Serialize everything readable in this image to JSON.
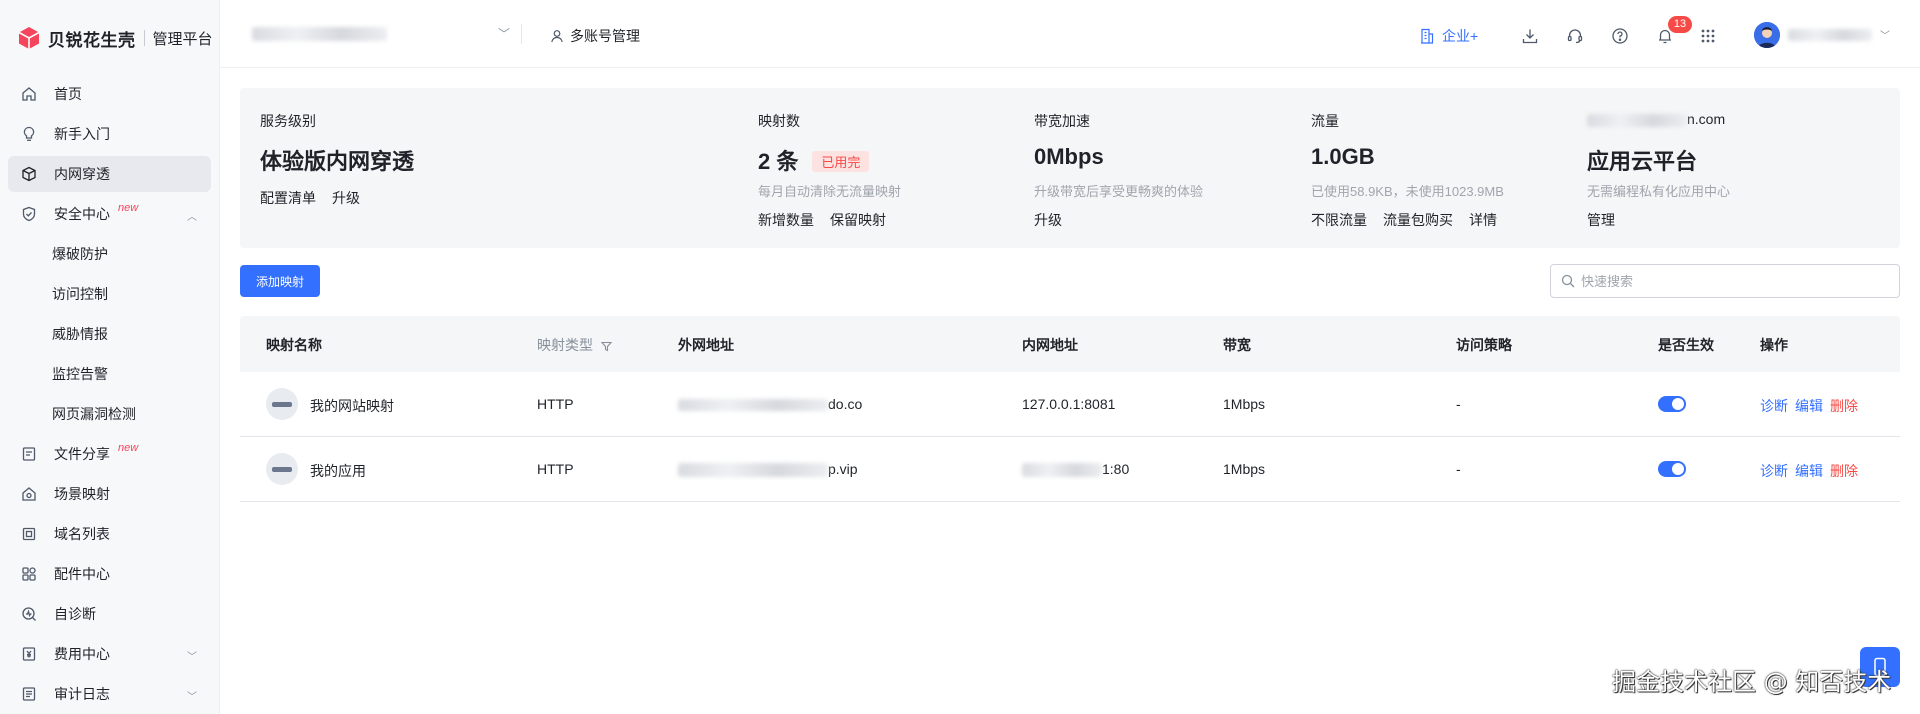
{
  "app": {
    "brand": "贝锐花生壳",
    "subtitle": "管理平台",
    "logo_icon": "cube-icon",
    "colors": {
      "accent": "#3370ff",
      "brand": "#f5455c",
      "danger": "#f54a45"
    }
  },
  "sidebar": {
    "items": [
      {
        "label": "首页",
        "icon": "home-icon"
      },
      {
        "label": "新手入门",
        "icon": "lightbulb-icon"
      },
      {
        "label": "内网穿透",
        "icon": "box-icon",
        "active": true
      },
      {
        "label": "安全中心",
        "icon": "shield-icon",
        "badge": "new",
        "expanded": true,
        "children": [
          "爆破防护",
          "访问控制",
          "威胁情报",
          "监控告警",
          "网页漏洞检测"
        ]
      },
      {
        "label": "文件分享",
        "icon": "file-share-icon",
        "badge": "new"
      },
      {
        "label": "场景映射",
        "icon": "scene-icon"
      },
      {
        "label": "域名列表",
        "icon": "domain-icon"
      },
      {
        "label": "配件中心",
        "icon": "grid-icon"
      },
      {
        "label": "自诊断",
        "icon": "diagnose-icon"
      },
      {
        "label": "费用中心",
        "icon": "yen-icon",
        "collapsed": true
      },
      {
        "label": "审计日志",
        "icon": "log-icon",
        "collapsed": true
      }
    ]
  },
  "header": {
    "multi_account": "多账号管理",
    "enterprise": "企业+",
    "notification_count": "13",
    "icons": [
      "download-icon",
      "headset-icon",
      "help-icon",
      "bell-icon",
      "apps-icon"
    ]
  },
  "stats": {
    "service": {
      "title": "服务级别",
      "value": "体验版内网穿透",
      "links": [
        "配置清单",
        "升级"
      ]
    },
    "mappings": {
      "title": "映射数",
      "value": "2 条",
      "tag": "已用完",
      "desc": "每月自动清除无流量映射",
      "links": [
        "新增数量",
        "保留映射"
      ]
    },
    "bandwidth": {
      "title": "带宽加速",
      "value": "0Mbps",
      "desc": "升级带宽后享受更畅爽的体验",
      "links": [
        "升级"
      ]
    },
    "traffic": {
      "title": "流量",
      "value": "1.0GB",
      "desc": "已使用58.9KB，未使用1023.9MB",
      "links": [
        "不限流量",
        "流量包购买",
        "详情"
      ]
    },
    "cloud": {
      "title": "n.com",
      "value": "应用云平台",
      "desc": "无需编程私有化应用中心",
      "links": [
        "管理"
      ]
    }
  },
  "toolbar": {
    "add_label": "添加映射",
    "search_placeholder": "快速搜索"
  },
  "table": {
    "columns": [
      "映射名称",
      "映射类型",
      "外网地址",
      "内网地址",
      "带宽",
      "访问策略",
      "是否生效",
      "操作"
    ],
    "rows": [
      {
        "name": "我的网站映射",
        "type": "HTTP",
        "external": "do.co",
        "internal": "127.0.0.1:8081",
        "bandwidth": "1Mbps",
        "policy": "-",
        "enabled": true
      },
      {
        "name": "我的应用",
        "type": "HTTP",
        "external": "p.vip",
        "internal": "1:80",
        "bandwidth": "1Mbps",
        "policy": "-",
        "enabled": true
      }
    ],
    "actions": {
      "diagnose": "诊断",
      "edit": "编辑",
      "delete": "删除"
    }
  },
  "watermark": "掘金技术社区 @ 知否技术"
}
